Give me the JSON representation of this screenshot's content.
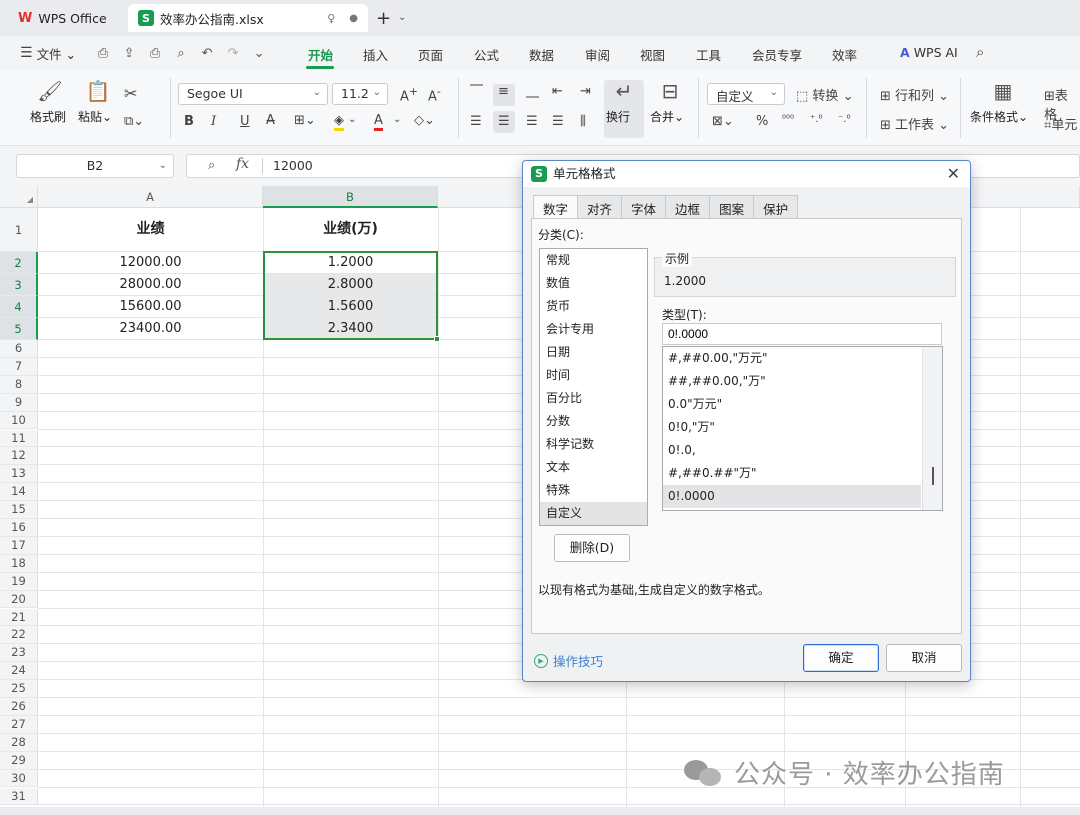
{
  "tabs": {
    "app": "WPS Office",
    "file": "效率办公指南.xlsx"
  },
  "menu": {
    "file": "文件",
    "items": [
      "开始",
      "插入",
      "页面",
      "公式",
      "数据",
      "审阅",
      "视图",
      "工具",
      "会员专享",
      "效率"
    ],
    "ai": "WPS AI"
  },
  "ribbon": {
    "format_painter": "格式刷",
    "paste": "粘贴",
    "font_name": "Segoe UI",
    "font_size": "11.2",
    "wrap": "换行",
    "merge": "合并",
    "number_format": "自定义",
    "convert": "转换",
    "rows_cols": "行和列",
    "worksheet": "工作表",
    "cond_format": "条件格式",
    "table_style": "表格",
    "cell": "单元",
    "bold": "B",
    "italic": "I",
    "underline": "U",
    "percent": "%"
  },
  "formula_bar": {
    "name_box": "B2",
    "fx": "fx",
    "value": "12000"
  },
  "sheet": {
    "columns": [
      "A",
      "B"
    ],
    "rows": [
      "1",
      "2",
      "3",
      "4",
      "5",
      "6",
      "7",
      "8",
      "9",
      "10",
      "11",
      "12",
      "13",
      "14",
      "15",
      "16",
      "17",
      "18",
      "19",
      "20",
      "21",
      "22",
      "23",
      "24",
      "25",
      "26",
      "27",
      "28",
      "29",
      "30",
      "31"
    ],
    "header_a": "业绩",
    "header_b": "业绩(万)",
    "data": [
      {
        "a": "12000.00",
        "b": "1.2000"
      },
      {
        "a": "28000.00",
        "b": "2.8000"
      },
      {
        "a": "15600.00",
        "b": "1.5600"
      },
      {
        "a": "23400.00",
        "b": "2.3400"
      }
    ]
  },
  "dialog": {
    "title": "单元格格式",
    "close": "✕",
    "tabs": [
      "数字",
      "对齐",
      "字体",
      "边框",
      "图案",
      "保护"
    ],
    "category_label": "分类(C):",
    "categories": [
      "常规",
      "数值",
      "货币",
      "会计专用",
      "日期",
      "时间",
      "百分比",
      "分数",
      "科学记数",
      "文本",
      "特殊",
      "自定义"
    ],
    "sample_label": "示例",
    "sample_value": "1.2000",
    "type_label": "类型(T):",
    "type_value": "0!.0000",
    "formats": [
      "#,##0.00,\"万元\"",
      "##,##0.00,\"万\"",
      "0.0\"万元\"",
      "0!0,\"万\"",
      "0!.0,",
      "#,##0.##\"万\"",
      "0!.0000"
    ],
    "delete_button": "删除(D)",
    "description": "以现有格式为基础,生成自定义的数字格式。",
    "tips": "操作技巧",
    "ok": "确定",
    "cancel": "取消"
  },
  "watermark": "公众号 · 效率办公指南",
  "colors": {
    "accent": "#1a9b52",
    "selection": "#2f8f3d",
    "link": "#3c7fd0"
  }
}
